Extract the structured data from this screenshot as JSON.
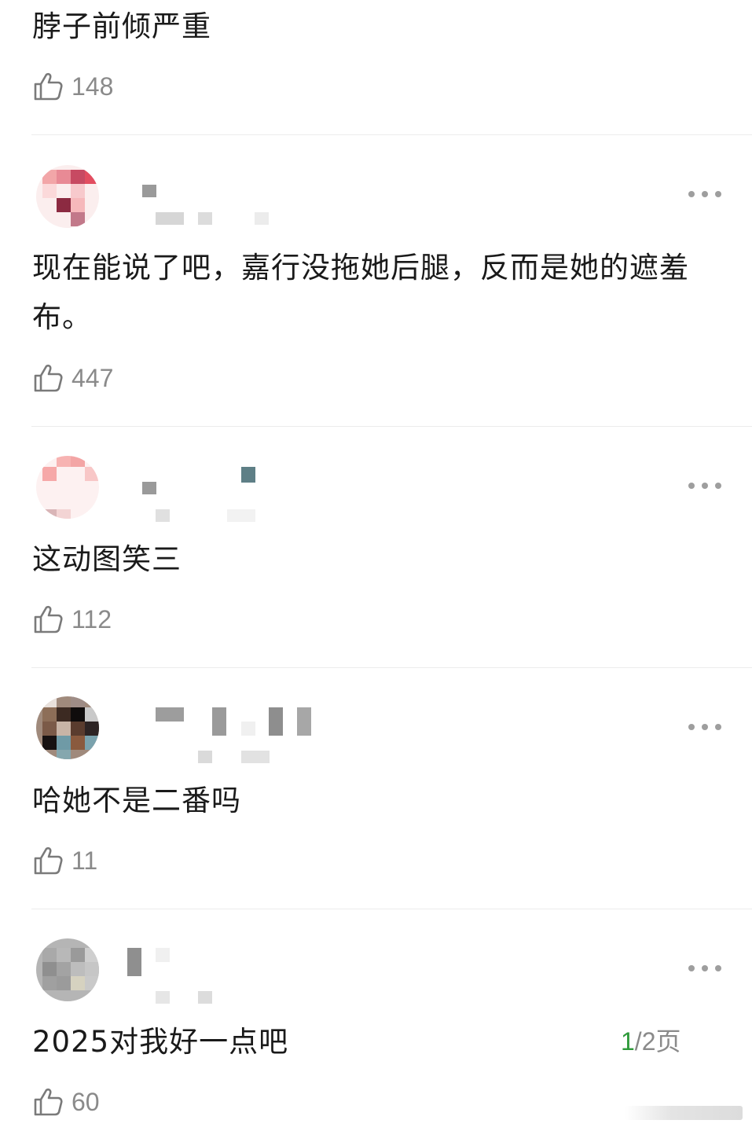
{
  "comments": [
    {
      "text": "脖子前倾严重",
      "likes": "148"
    },
    {
      "text": "现在能说了吧，嘉行没拖她后腿，反而是她的遮羞布。",
      "likes": "447"
    },
    {
      "text": "这动图笑三",
      "likes": "112"
    },
    {
      "text": "哈她不是二番吗",
      "likes": "11"
    },
    {
      "text": "2025对我好一点吧",
      "likes": "60"
    }
  ],
  "pagination": {
    "current": "1",
    "rest": "/2页"
  },
  "icons": {
    "like": "thumbs-up-outline-icon",
    "more": "more-dots-icon"
  },
  "colors": {
    "page_current": "#2e9a3a",
    "count_gray": "#8a8a8a",
    "divider": "#ececec"
  }
}
